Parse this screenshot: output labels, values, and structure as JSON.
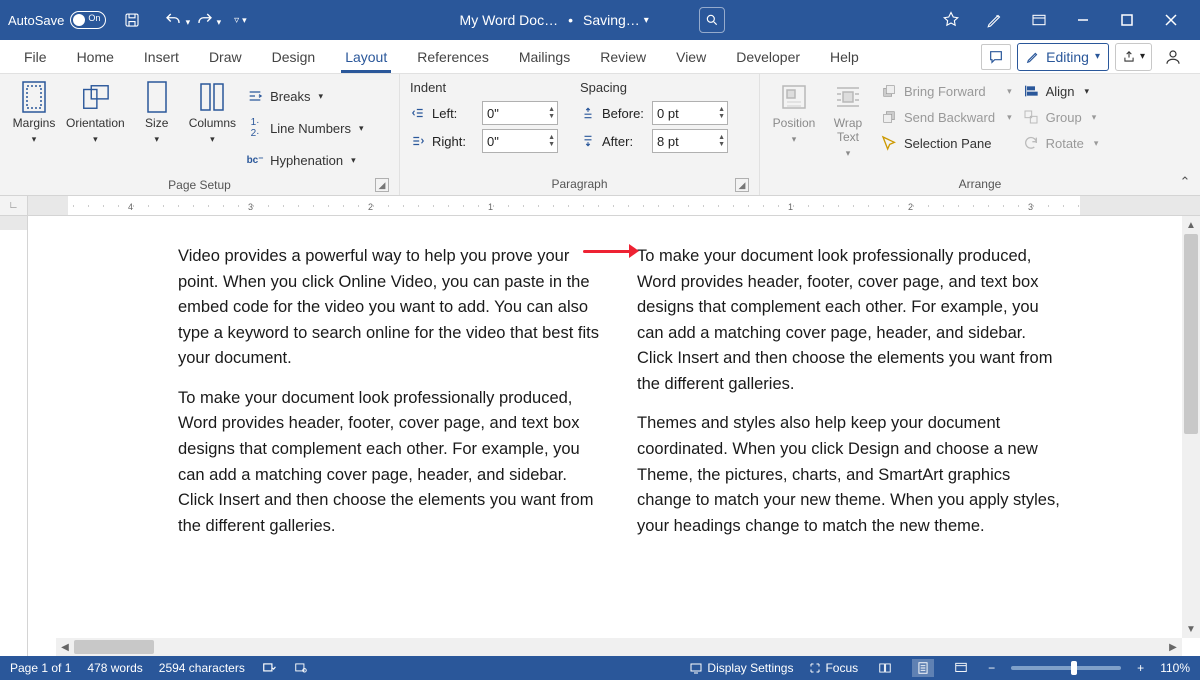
{
  "titlebar": {
    "autosave": "AutoSave",
    "autosave_state": "On",
    "doc_name": "My Word Doc…",
    "saving": "Saving…"
  },
  "tabs": {
    "items": [
      "File",
      "Home",
      "Insert",
      "Draw",
      "Design",
      "Layout",
      "References",
      "Mailings",
      "Review",
      "View",
      "Developer",
      "Help"
    ],
    "active_idx": 5,
    "editing": "Editing"
  },
  "ribbon": {
    "page_setup": {
      "label": "Page Setup",
      "margins": "Margins",
      "orientation": "Orientation",
      "size": "Size",
      "columns": "Columns",
      "breaks": "Breaks",
      "line_numbers": "Line Numbers",
      "hyphenation": "Hyphenation"
    },
    "paragraph": {
      "label": "Paragraph",
      "indent": "Indent",
      "spacing": "Spacing",
      "left": "Left:",
      "right": "Right:",
      "before": "Before:",
      "after": "After:",
      "left_val": "0\"",
      "right_val": "0\"",
      "before_val": "0 pt",
      "after_val": "8 pt"
    },
    "arrange": {
      "label": "Arrange",
      "position": "Position",
      "wrap": "Wrap\nText",
      "bring_forward": "Bring Forward",
      "send_backward": "Send Backward",
      "selection_pane": "Selection Pane",
      "align": "Align",
      "group": "Group",
      "rotate": "Rotate"
    }
  },
  "document": {
    "col1": {
      "p1": "Video provides a powerful way to help you prove your point. When you click Online Video, you can paste in the embed code for the video you want to add. You can also type a keyword to search online for the video that best fits your document.",
      "p2": "To make your document look professionally produced, Word provides header, footer, cover page, and text box designs that complement each other. For example, you can add a matching cover page, header, and sidebar. Click Insert and then choose the elements you want from the different galleries."
    },
    "col2": {
      "p1": "To make your document look professionally produced, Word provides header, footer, cover page, and text box designs that complement each other. For example, you can add a matching cover page, header, and sidebar. Click Insert and then choose the elements you want from the different galleries.",
      "p2": "Themes and styles also help keep your document coordinated. When you click Design and choose a new Theme, the pictures, charts, and SmartArt graphics change to match your new theme. When you apply styles, your headings change to match the new theme."
    }
  },
  "status": {
    "page": "Page 1 of 1",
    "words": "478 words",
    "chars": "2594 characters",
    "display": "Display Settings",
    "focus": "Focus",
    "zoom": "110%"
  }
}
